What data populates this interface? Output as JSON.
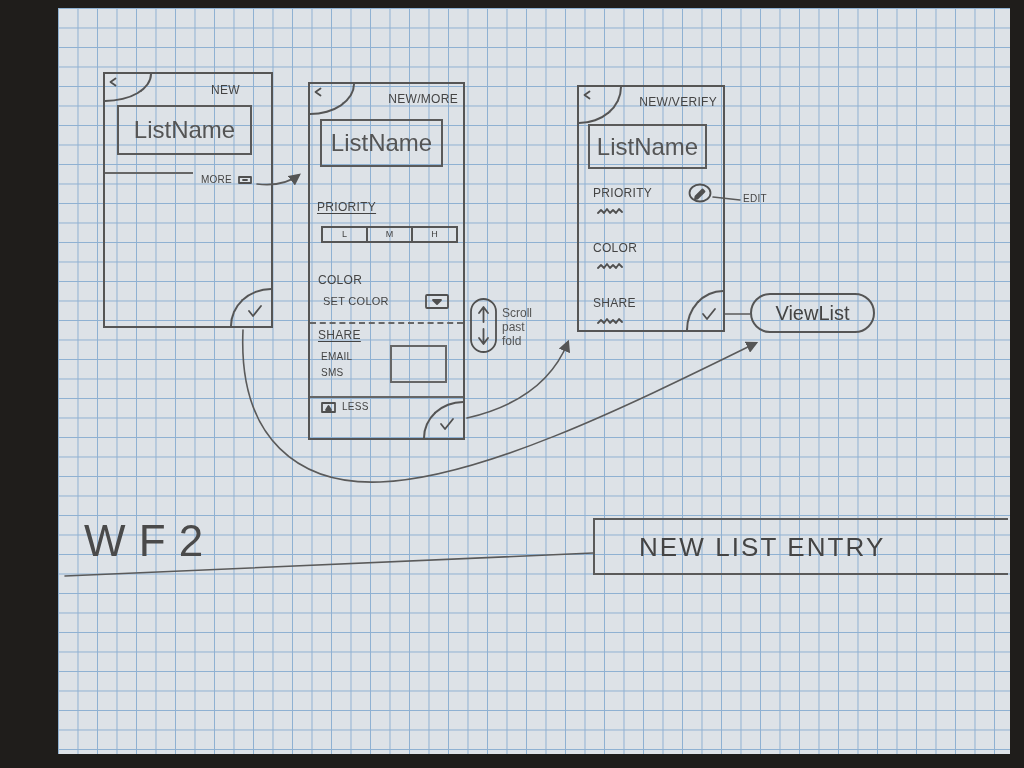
{
  "screens": [
    {
      "kind": "new",
      "heading": "NEW",
      "name_field": {
        "value": "ListName"
      },
      "more_toggle": {
        "label": "MORE"
      }
    },
    {
      "kind": "more",
      "heading": "NEW/MORE",
      "name_field": {
        "value": "ListName"
      },
      "priority": {
        "label": "PRIORITY",
        "options": [
          {
            "label": "L",
            "selected": false
          },
          {
            "label": "M",
            "selected": false
          },
          {
            "label": "H",
            "selected": false
          }
        ]
      },
      "color": {
        "label": "COLOR",
        "dropdown": {
          "value": "SET COLOR"
        }
      },
      "share": {
        "label": "SHARE",
        "options": [
          "EMAIL",
          "SMS"
        ]
      },
      "less_toggle": {
        "label": "LESS"
      },
      "scroll_note": "Scroll past fold"
    },
    {
      "kind": "verify",
      "heading": "NEW/VERIFY",
      "name_field": {
        "value": "ListName"
      },
      "summary": [
        {
          "label": "PRIORITY",
          "editable": true
        },
        {
          "label": "COLOR",
          "editable": false
        },
        {
          "label": "SHARE",
          "editable": false
        }
      ],
      "edit_note": "EDIT",
      "view_list_button": {
        "label": "ViewList"
      }
    }
  ],
  "sheet_label": "WF2",
  "sheet_title": "NEW LIST ENTRY"
}
